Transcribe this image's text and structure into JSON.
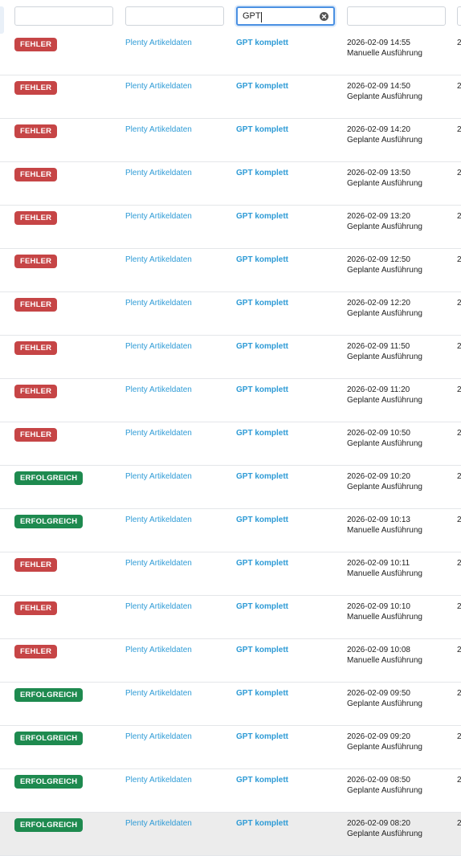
{
  "filters": [
    {
      "value": "",
      "placeholder": ""
    },
    {
      "value": "",
      "placeholder": ""
    },
    {
      "value": "GPT",
      "placeholder": ""
    },
    {
      "value": "",
      "placeholder": ""
    }
  ],
  "icons": {
    "clear": "clear-x-circle-icon"
  },
  "colors": {
    "fail": "#c64546",
    "ok": "#1e8a4f",
    "link": "#2e9bd6",
    "focus": "#4a90e2"
  },
  "rows": [
    {
      "status": "FEHLER",
      "source": "Plenty Artikeldaten",
      "job": "GPT komplett",
      "datetime": "2026-02-09 14:55",
      "runtype": "Manuelle Ausführung",
      "next_col": "2"
    },
    {
      "status": "FEHLER",
      "source": "Plenty Artikeldaten",
      "job": "GPT komplett",
      "datetime": "2026-02-09 14:50",
      "runtype": "Geplante Ausführung",
      "next_col": "2"
    },
    {
      "status": "FEHLER",
      "source": "Plenty Artikeldaten",
      "job": "GPT komplett",
      "datetime": "2026-02-09 14:20",
      "runtype": "Geplante Ausführung",
      "next_col": "2"
    },
    {
      "status": "FEHLER",
      "source": "Plenty Artikeldaten",
      "job": "GPT komplett",
      "datetime": "2026-02-09 13:50",
      "runtype": "Geplante Ausführung",
      "next_col": "2"
    },
    {
      "status": "FEHLER",
      "source": "Plenty Artikeldaten",
      "job": "GPT komplett",
      "datetime": "2026-02-09 13:20",
      "runtype": "Geplante Ausführung",
      "next_col": "2"
    },
    {
      "status": "FEHLER",
      "source": "Plenty Artikeldaten",
      "job": "GPT komplett",
      "datetime": "2026-02-09 12:50",
      "runtype": "Geplante Ausführung",
      "next_col": "2"
    },
    {
      "status": "FEHLER",
      "source": "Plenty Artikeldaten",
      "job": "GPT komplett",
      "datetime": "2026-02-09 12:20",
      "runtype": "Geplante Ausführung",
      "next_col": "2"
    },
    {
      "status": "FEHLER",
      "source": "Plenty Artikeldaten",
      "job": "GPT komplett",
      "datetime": "2026-02-09 11:50",
      "runtype": "Geplante Ausführung",
      "next_col": "2"
    },
    {
      "status": "FEHLER",
      "source": "Plenty Artikeldaten",
      "job": "GPT komplett",
      "datetime": "2026-02-09 11:20",
      "runtype": "Geplante Ausführung",
      "next_col": "2"
    },
    {
      "status": "FEHLER",
      "source": "Plenty Artikeldaten",
      "job": "GPT komplett",
      "datetime": "2026-02-09 10:50",
      "runtype": "Geplante Ausführung",
      "next_col": "2"
    },
    {
      "status": "ERFOLGREICH",
      "source": "Plenty Artikeldaten",
      "job": "GPT komplett",
      "datetime": "2026-02-09 10:20",
      "runtype": "Geplante Ausführung",
      "next_col": "2"
    },
    {
      "status": "ERFOLGREICH",
      "source": "Plenty Artikeldaten",
      "job": "GPT komplett",
      "datetime": "2026-02-09 10:13",
      "runtype": "Manuelle Ausführung",
      "next_col": "2"
    },
    {
      "status": "FEHLER",
      "source": "Plenty Artikeldaten",
      "job": "GPT komplett",
      "datetime": "2026-02-09 10:11",
      "runtype": "Manuelle Ausführung",
      "next_col": "2"
    },
    {
      "status": "FEHLER",
      "source": "Plenty Artikeldaten",
      "job": "GPT komplett",
      "datetime": "2026-02-09 10:10",
      "runtype": "Manuelle Ausführung",
      "next_col": "2"
    },
    {
      "status": "FEHLER",
      "source": "Plenty Artikeldaten",
      "job": "GPT komplett",
      "datetime": "2026-02-09 10:08",
      "runtype": "Manuelle Ausführung",
      "next_col": "2"
    },
    {
      "status": "ERFOLGREICH",
      "source": "Plenty Artikeldaten",
      "job": "GPT komplett",
      "datetime": "2026-02-09 09:50",
      "runtype": "Geplante Ausführung",
      "next_col": "2"
    },
    {
      "status": "ERFOLGREICH",
      "source": "Plenty Artikeldaten",
      "job": "GPT komplett",
      "datetime": "2026-02-09 09:20",
      "runtype": "Geplante Ausführung",
      "next_col": "2"
    },
    {
      "status": "ERFOLGREICH",
      "source": "Plenty Artikeldaten",
      "job": "GPT komplett",
      "datetime": "2026-02-09 08:50",
      "runtype": "Geplante Ausführung",
      "next_col": "2"
    },
    {
      "status": "ERFOLGREICH",
      "source": "Plenty Artikeldaten",
      "job": "GPT komplett",
      "datetime": "2026-02-09 08:20",
      "runtype": "Geplante Ausführung",
      "next_col": "2"
    }
  ]
}
